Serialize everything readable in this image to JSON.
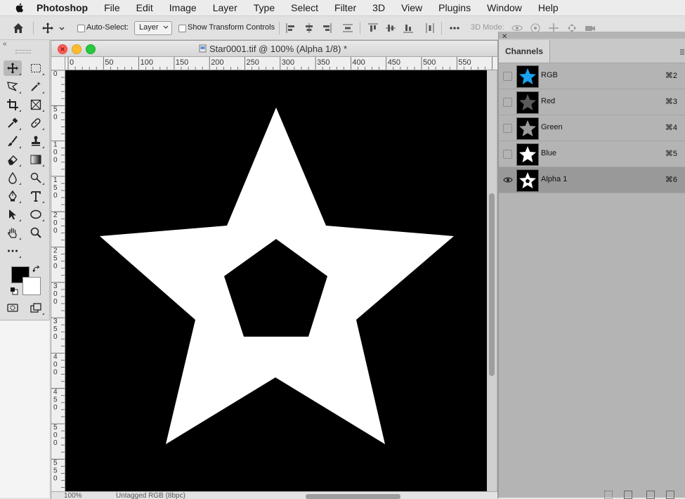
{
  "menubar": {
    "app": "Photoshop",
    "items": [
      "File",
      "Edit",
      "Image",
      "Layer",
      "Type",
      "Select",
      "Filter",
      "3D",
      "View",
      "Plugins",
      "Window",
      "Help"
    ]
  },
  "options_bar": {
    "auto_select_label": "Auto-Select:",
    "auto_select_target": "Layer",
    "show_transform_label": "Show Transform Controls",
    "mode_3d_label": "3D Mode:"
  },
  "document": {
    "title": "Star0001.tif @ 100% (Alpha 1/8) *",
    "zoom": "100%",
    "color_profile": "Untagged RGB (8bpc)",
    "h_ruler_labels": [
      "0",
      "50",
      "100",
      "150",
      "200",
      "250",
      "300",
      "350",
      "400",
      "450",
      "500",
      "550"
    ],
    "v_ruler_labels": [
      "0",
      "5\n0",
      "1\n0\n0",
      "1\n5\n0",
      "2\n0\n0",
      "2\n5\n0",
      "3\n0\n0",
      "3\n5\n0",
      "4\n0\n0",
      "4\n5\n0",
      "5\n0\n0",
      "5\n5\n0"
    ]
  },
  "channels_panel": {
    "tab_label": "Channels",
    "channels": [
      {
        "name": "RGB",
        "shortcut": "⌘2",
        "visible": false,
        "selected": false,
        "thumb": "rgb"
      },
      {
        "name": "Red",
        "shortcut": "⌘3",
        "visible": false,
        "selected": false,
        "thumb": "red"
      },
      {
        "name": "Green",
        "shortcut": "⌘4",
        "visible": false,
        "selected": false,
        "thumb": "green"
      },
      {
        "name": "Blue",
        "shortcut": "⌘5",
        "visible": false,
        "selected": false,
        "thumb": "blue"
      },
      {
        "name": "Alpha 1",
        "shortcut": "⌘6",
        "visible": true,
        "selected": true,
        "thumb": "alpha"
      }
    ]
  },
  "colors": {
    "foreground": "#000000",
    "background": "#ffffff",
    "rgb_thumb_star": "#1aa3f0",
    "selected_row": "#999999"
  }
}
